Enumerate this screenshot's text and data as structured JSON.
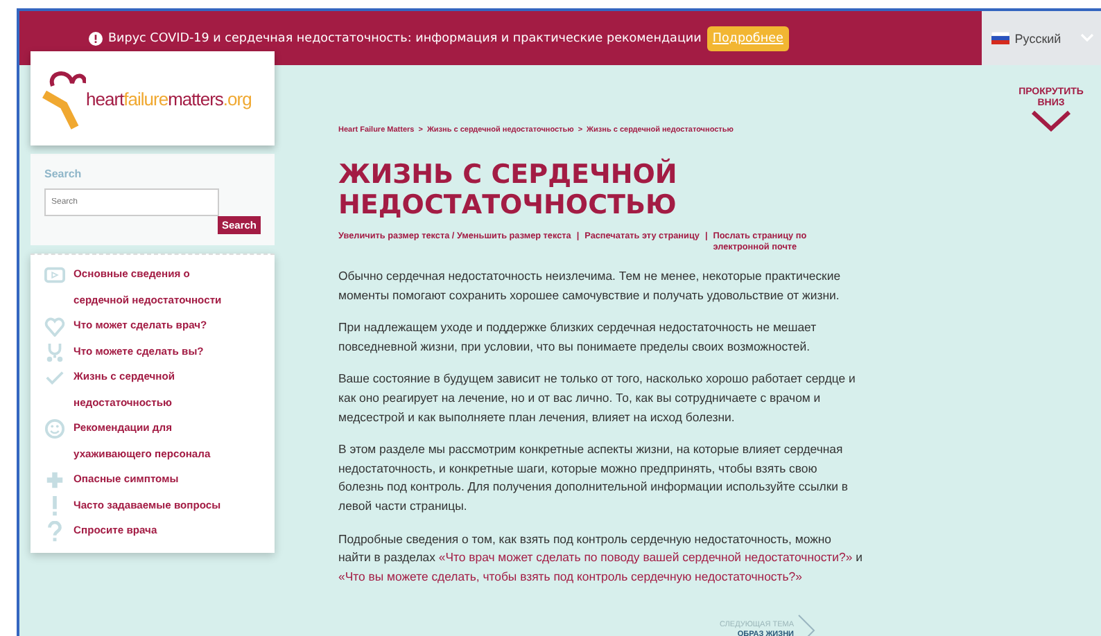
{
  "banner": {
    "text": "Вирус COVID-19 и сердечная недостаточность: информация и практические рекомендации",
    "button": "Подробнее",
    "language": "Русский"
  },
  "logo": {
    "parts": [
      {
        "text": "heart",
        "color": "#a31c44"
      },
      {
        "text": "failure",
        "color": "#f0a830"
      },
      {
        "text": "matters",
        "color": "#a31c44"
      },
      {
        "text": ".org",
        "color": "#f0a830"
      }
    ]
  },
  "search": {
    "label": "Search",
    "placeholder": "Search",
    "button": "Search"
  },
  "nav": [
    {
      "kind": "video",
      "label": "Основные сведения о сердечной недостаточности"
    },
    {
      "kind": "heart",
      "label": "Что может сделать врач?"
    },
    {
      "kind": "stethoscope",
      "label": "Что можете сделать вы?"
    },
    {
      "kind": "check",
      "label": "Жизнь с сердечной недостаточностью"
    },
    {
      "kind": "smile",
      "label": "Рекомендации для ухаживающего персонала"
    },
    {
      "kind": "plus",
      "label": "Опасные симптомы"
    },
    {
      "kind": "exclamation",
      "label": "Часто задаваемые вопросы"
    },
    {
      "kind": "question",
      "label": "Спросите врача"
    }
  ],
  "scroll_down": "ПРОКРУТИТЬ ВНИЗ",
  "breadcrumb_separator": ">",
  "tool_separator": "|",
  "breadcrumbs": [
    "Heart Failure Matters",
    "Жизнь с сердечной недостаточностью",
    "Жизнь с сердечной недостаточностью"
  ],
  "title": "ЖИЗНЬ С СЕРДЕЧНОЙ НЕДОСТАТОЧНОСТЬЮ",
  "tools": [
    "Увеличить размер текста / Уменьшить размер текста",
    "Распечатать эту страницу",
    "Послать страницу по электронной почте"
  ],
  "paragraphs": [
    {
      "text": "Обычно сердечная недостаточность неизлечима. Тем не менее, некоторые практические моменты помогают сохранить хорошее самочувствие и получать удовольствие от жизни."
    },
    {
      "text": "При надлежащем уходе и поддержке близких сердечная недостаточность не мешает повседневной жизни, при условии, что вы понимаете пределы своих возможностей."
    },
    {
      "text": "Ваше состояние в будущем зависит не только от того, насколько хорошо работает сердце и как оно реагирует на лечение, но и от вас лично. То, как вы сотрудничаете с врачом и медсестрой и как выполняете план лечения, влияет на исход болезни."
    },
    {
      "text": "В этом разделе мы рассмотрим конкретные аспекты жизни, на которые влияет сердечная недостаточность, и конкретные шаги, которые можно предпринять, чтобы взять свою болезнь под контроль. Для получения дополнительной информации используйте ссылки в левой части страницы."
    },
    {
      "text": "Подробные сведения о том, как взять под контроль сердечную недостаточность, можно найти в разделах",
      "links": [
        "«Что врач может сделать по поводу вашей сердечной недостаточности?»",
        "«Что вы можете сделать, чтобы взять под контроль сердечную недостаточность?»"
      ],
      "joiner": "и"
    }
  ],
  "next_topic": {
    "label": "СЛЕДУЮЩАЯ ТЕМА",
    "title": "ОБРАЗ ЖИЗНИ"
  }
}
